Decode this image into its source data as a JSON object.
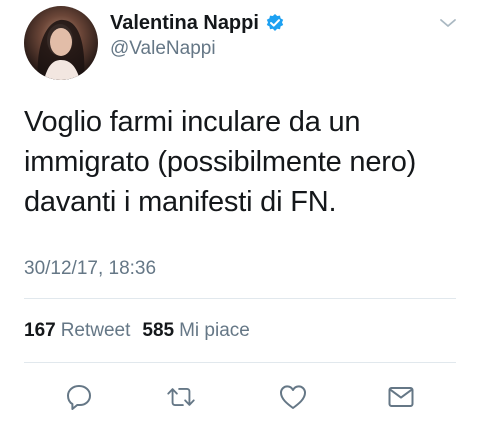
{
  "author": {
    "name": "Valentina Nappi",
    "handle": "@ValeNappi"
  },
  "tweet": {
    "lines": [
      "Voglio farmi inculare da un",
      "immigrato (possibilmente nero)",
      "davanti i manifesti di FN."
    ],
    "timestamp": "30/12/17, 18:36"
  },
  "stats": {
    "retweets_count": "167",
    "retweets_label": "Retweet",
    "likes_count": "585",
    "likes_label": "Mi piace"
  },
  "icons": {
    "verified": "verified-badge-icon",
    "caret": "chevron-down-icon",
    "reply": "reply-icon",
    "retweet": "retweet-icon",
    "like": "heart-icon",
    "message": "envelope-icon"
  },
  "colors": {
    "verified_blue": "#1da1f2",
    "secondary_text": "#657786",
    "primary_text": "#14171a",
    "divider": "#e1e8ed"
  }
}
